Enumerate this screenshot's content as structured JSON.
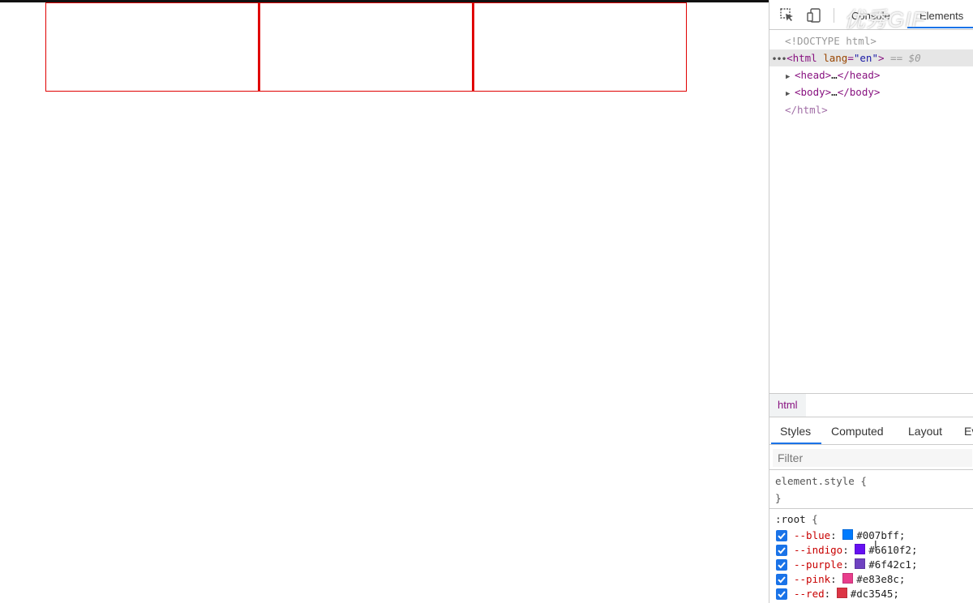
{
  "page": {
    "box_count": 3
  },
  "devtools": {
    "tabs": {
      "console": "Console",
      "elements": "Elements"
    },
    "watermark": "优秀GIF",
    "dom": {
      "doctype": "<!DOCTYPE html>",
      "html_open_tag": "html",
      "html_attr_name": "lang",
      "html_attr_value": "\"en\"",
      "selected_marker": "== $0",
      "head_tag": "head",
      "body_tag": "body",
      "ellipsis": "…",
      "html_close": "</html>"
    },
    "breadcrumb": "html",
    "style_tabs": {
      "styles": "Styles",
      "computed": "Computed",
      "layout": "Layout",
      "event_listeners": "Ev"
    },
    "filter_placeholder": "Filter",
    "element_style": {
      "selector": "element.style",
      "open": "{",
      "close": "}"
    },
    "root_rule": {
      "selector": ":root",
      "open": "{",
      "properties": [
        {
          "name": "--blue",
          "value": "#007bff",
          "color": "#007bff"
        },
        {
          "name": "--indigo",
          "value": "#6610f2",
          "color": "#6610f2"
        },
        {
          "name": "--purple",
          "value": "#6f42c1",
          "color": "#6f42c1"
        },
        {
          "name": "--pink",
          "value": "#e83e8c",
          "color": "#e83e8c"
        },
        {
          "name": "--red",
          "value": "#dc3545",
          "color": "#dc3545"
        }
      ]
    }
  },
  "colors": {
    "box_border": "#e00000",
    "accent": "#1a73e8"
  }
}
